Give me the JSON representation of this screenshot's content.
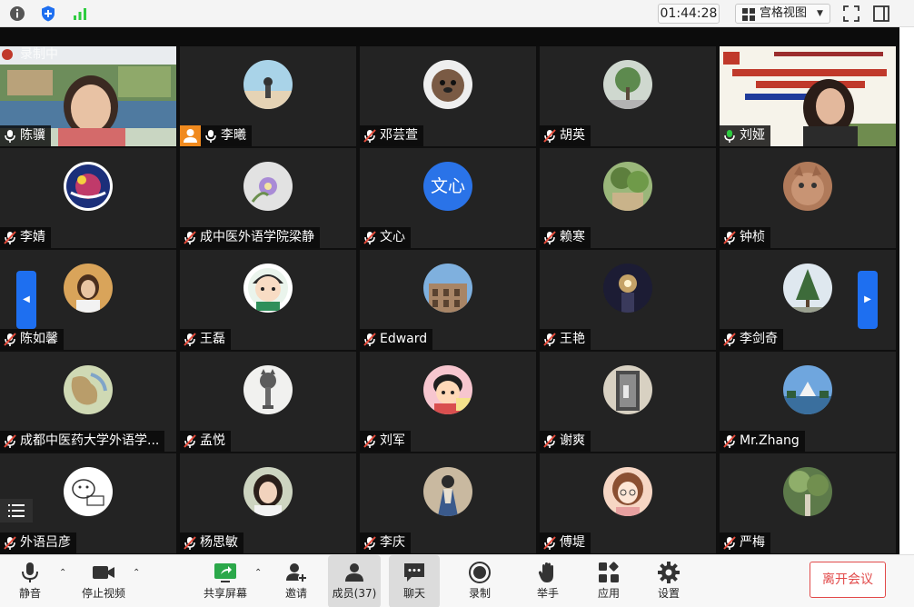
{
  "topbar": {
    "timer": "01:44:28",
    "view_label": "宫格视图",
    "icons": [
      "info-icon",
      "shield-icon",
      "signal-icon",
      "grid-view-icon",
      "fullscreen-icon",
      "sidebar-toggle-icon"
    ]
  },
  "recording_label": "录制中",
  "participants": [
    {
      "name": "陈骥",
      "mic": "on",
      "type": "video"
    },
    {
      "name": "李曦",
      "mic": "on",
      "type": "avatar",
      "host": true
    },
    {
      "name": "邓芸萱",
      "mic": "muted",
      "type": "avatar"
    },
    {
      "name": "胡英",
      "mic": "muted",
      "type": "avatar"
    },
    {
      "name": "刘娅",
      "mic": "active",
      "type": "video"
    },
    {
      "name": "李婧",
      "mic": "muted",
      "type": "avatar"
    },
    {
      "name": "成中医外语学院梁静",
      "mic": "muted",
      "type": "avatar"
    },
    {
      "name": "文心",
      "mic": "muted",
      "type": "initials",
      "initials": "文心"
    },
    {
      "name": "赖寒",
      "mic": "muted",
      "type": "avatar"
    },
    {
      "name": "钟桢",
      "mic": "muted",
      "type": "avatar"
    },
    {
      "name": "陈如馨",
      "mic": "muted",
      "type": "avatar"
    },
    {
      "name": "王磊",
      "mic": "muted",
      "type": "avatar"
    },
    {
      "name": "Edward",
      "mic": "muted",
      "type": "avatar"
    },
    {
      "name": "王艳",
      "mic": "muted",
      "type": "avatar"
    },
    {
      "name": "李剑奇",
      "mic": "muted",
      "type": "avatar"
    },
    {
      "name": "成都中医药大学外语学...",
      "mic": "muted",
      "type": "avatar"
    },
    {
      "name": "孟悦",
      "mic": "muted",
      "type": "avatar"
    },
    {
      "name": "刘军",
      "mic": "muted",
      "type": "avatar"
    },
    {
      "name": "谢爽",
      "mic": "muted",
      "type": "avatar"
    },
    {
      "name": "Mr.Zhang",
      "mic": "muted",
      "type": "avatar"
    },
    {
      "name": "外语吕彦",
      "mic": "muted",
      "type": "avatar"
    },
    {
      "name": "杨思敏",
      "mic": "muted",
      "type": "avatar"
    },
    {
      "name": "李庆",
      "mic": "muted",
      "type": "avatar"
    },
    {
      "name": "傅堤",
      "mic": "muted",
      "type": "avatar"
    },
    {
      "name": "严梅",
      "mic": "muted",
      "type": "avatar"
    }
  ],
  "toolbar": {
    "mute": "静音",
    "stop_video": "停止视频",
    "share_screen": "共享屏幕",
    "invite": "邀请",
    "members": "成员(37)",
    "chat": "聊天",
    "record": "录制",
    "raise_hand": "举手",
    "apps": "应用",
    "settings": "设置",
    "leave": "离开会议"
  },
  "colors": {
    "accent": "#1e6ff0",
    "leave": "#e24a4a",
    "host_badge": "#f08a1e",
    "active_mic": "#2ecc40"
  }
}
